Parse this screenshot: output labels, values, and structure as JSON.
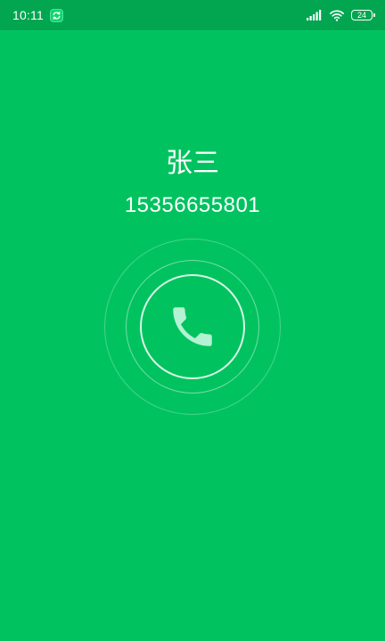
{
  "status_bar": {
    "time": "10:11",
    "battery": "24",
    "icons": [
      "sync-icon",
      "signal-icon",
      "wifi-icon",
      "battery-icon"
    ]
  },
  "call": {
    "caller_name": "张三",
    "phone_number": "15356655801"
  },
  "controls": {
    "answer_icon": "phone-icon"
  },
  "colors": {
    "background": "#00c35f",
    "status_bar": "#02a650",
    "phone_icon": "#b3f2d2",
    "text": "#ffffff"
  }
}
